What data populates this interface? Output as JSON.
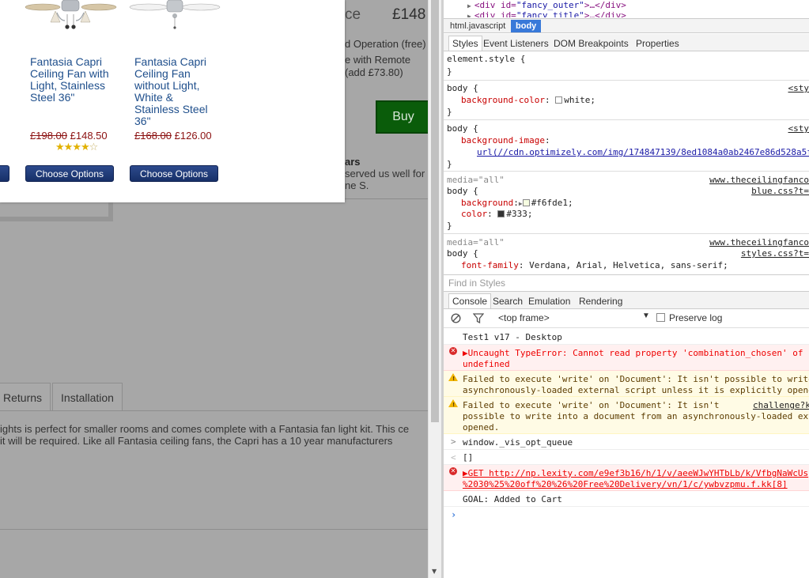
{
  "site": {
    "price_label": "ce",
    "price": "£148",
    "line1": "d Operation (free)",
    "line2": "e with Remote",
    "line3": "(add £73.80)",
    "buy_label": "Buy",
    "years": "ars",
    "served": "served us well for",
    "name": "ne S.",
    "tabs": [
      "Returns",
      "Installation"
    ],
    "desc_line1": "ights is perfect for smaller rooms and comes complete with a Fantasia fan light kit. This ce",
    "desc_line2": "it will be required. Like all Fantasia ceiling fans, the Capri has a 10 year manufacturers"
  },
  "modal": {
    "products": [
      {
        "name_lines": [
          "Fantasia Capri",
          "Ceiling Fan with",
          "Light, Stainless",
          "Steel 36\""
        ],
        "old_price": "£198.00",
        "new_price": "£148.50",
        "rating": 4,
        "button": "Choose Options"
      },
      {
        "name_lines": [
          "Fantasia Capri",
          "Ceiling Fan",
          "without Light,",
          "White &",
          "Stainless Steel",
          "36\""
        ],
        "old_price": "£168.00",
        "new_price": "£126.00",
        "button": "Choose Options"
      }
    ]
  },
  "devtools": {
    "dom": [
      {
        "tag": "<div id=",
        "attr_v": "\"fancy_outer\"",
        "rest": ">…</div>"
      },
      {
        "tag": "<div id=",
        "attr_v": "\"fancy_title\"",
        "rest": ">…</div>"
      }
    ],
    "breadcrumb": [
      "html.javascript",
      "body"
    ],
    "panel_tabs": [
      "Styles",
      "Event Listeners",
      "DOM Breakpoints",
      "Properties"
    ],
    "styles": {
      "element_style": "element.style {",
      "rules": [
        {
          "selector": "body {",
          "src": "<sty",
          "props": [
            {
              "name": "background-color",
              "value": "white;",
              "swatch": "#ffffff"
            }
          ]
        },
        {
          "selector": "body {",
          "src": "<sty",
          "props": [
            {
              "name": "background-image",
              "value": ""
            }
          ],
          "url": "url(//cdn.optimizely.com/img/174847139/8ed1084a0ab2467e86d528a5f"
        },
        {
          "media": "media=\"all\"",
          "src1": "www.theceilingfanco",
          "src2": "blue.css?t=",
          "selector": "body {",
          "props": [
            {
              "name": "background",
              "value": "#f6fde1;",
              "swatch": "#f6fde1"
            },
            {
              "name": "color",
              "value": "#333;",
              "swatch": "#333333"
            }
          ]
        },
        {
          "media": "media=\"all\"",
          "src1": "www.theceilingfanco",
          "src2": "styles.css?t=",
          "selector": "body {",
          "props": [
            {
              "name": "font-family",
              "value": "Verdana, Arial, Helvetica, sans-serif;"
            }
          ]
        }
      ],
      "close": "}"
    },
    "find_placeholder": "Find in Styles",
    "console_tabs": [
      "Console",
      "Search",
      "Emulation",
      "Rendering"
    ],
    "frame": "<top frame>",
    "preserve_log": "Preserve log",
    "messages": [
      {
        "type": "log",
        "text": [
          "Test1 v17 - Desktop"
        ]
      },
      {
        "type": "error",
        "text": [
          "▶Uncaught TypeError: Cannot read property 'combination_chosen' of",
          "undefined"
        ]
      },
      {
        "type": "warn",
        "text": [
          "Failed to execute 'write' on 'Document': It isn't possible to write",
          "asynchronously-loaded external script unless it is explicitly opene"
        ]
      },
      {
        "type": "warn",
        "text": [
          "Failed to execute 'write' on 'Document': It isn't",
          "possible to write into a document from an asynchronously-loaded ext",
          "opened."
        ],
        "src": "challenge?k"
      },
      {
        "type": "input",
        "text": [
          "window._vis_opt_queue"
        ]
      },
      {
        "type": "output",
        "text": [
          "[]"
        ]
      },
      {
        "type": "error",
        "text": [
          "▶GET http://np.lexity.com/e9ef3b16/h/1/v/aeeWJwYHTbLb/k/VfbgNaWcUs",
          "%2030%25%20off%20%26%20Free%20Delivery/vn/1/c/ywbvzpmu.f.kk[8]"
        ]
      },
      {
        "type": "log",
        "text": [
          "GOAL: Added to Cart"
        ]
      }
    ],
    "colors": {
      "accent": "#3879d9",
      "error": "#e00000",
      "warning": "#f1b500"
    }
  }
}
